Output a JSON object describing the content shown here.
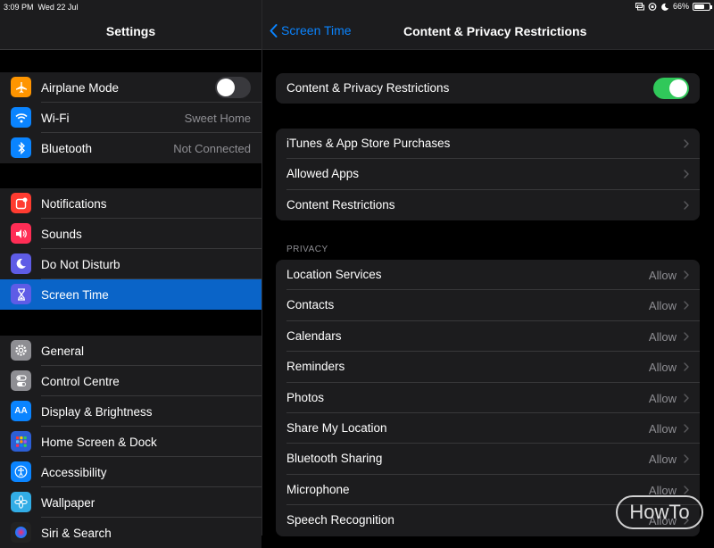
{
  "status_bar": {
    "time": "3:09 PM",
    "date": "Wed 22 Jul",
    "battery_percent": "66%",
    "battery_level": 0.66,
    "icons": [
      "screen-mirroring-icon",
      "orientation-lock-icon",
      "do-not-disturb-moon-icon"
    ]
  },
  "sidebar": {
    "title": "Settings",
    "groups": [
      {
        "items": [
          {
            "label": "Airplane Mode",
            "icon": "airplane-icon",
            "color": "#ff9500",
            "toggle": false
          },
          {
            "label": "Wi-Fi",
            "icon": "wifi-icon",
            "color": "#0a84ff",
            "value": "Sweet Home"
          },
          {
            "label": "Bluetooth",
            "icon": "bluetooth-icon",
            "color": "#0a84ff",
            "value": "Not Connected"
          }
        ]
      },
      {
        "items": [
          {
            "label": "Notifications",
            "icon": "notifications-icon",
            "color": "#ff3b30"
          },
          {
            "label": "Sounds",
            "icon": "speaker-icon",
            "color": "#ff2d55"
          },
          {
            "label": "Do Not Disturb",
            "icon": "moon-icon",
            "color": "#5e5ce6"
          },
          {
            "label": "Screen Time",
            "icon": "hourglass-icon",
            "color": "#5e5ce6",
            "selected": true
          }
        ]
      },
      {
        "items": [
          {
            "label": "General",
            "icon": "gear-icon",
            "color": "#8e8e93"
          },
          {
            "label": "Control Centre",
            "icon": "toggles-icon",
            "color": "#8e8e93"
          },
          {
            "label": "Display & Brightness",
            "icon": "text-size-icon",
            "color": "#0a84ff"
          },
          {
            "label": "Home Screen & Dock",
            "icon": "app-grid-icon",
            "color": "#2c5fd6"
          },
          {
            "label": "Accessibility",
            "icon": "accessibility-icon",
            "color": "#0a84ff"
          },
          {
            "label": "Wallpaper",
            "icon": "flower-icon",
            "color": "#32ade6"
          },
          {
            "label": "Siri & Search",
            "icon": "siri-icon",
            "color": "#222"
          }
        ]
      }
    ],
    "icon_glyphs": {
      "text-size-icon": "AA"
    }
  },
  "main": {
    "back_label": "Screen Time",
    "title": "Content & Privacy Restrictions",
    "toggle_row": {
      "label": "Content & Privacy Restrictions",
      "on": true
    },
    "store_rows": [
      {
        "label": "iTunes & App Store Purchases"
      },
      {
        "label": "Allowed Apps"
      },
      {
        "label": "Content Restrictions"
      }
    ],
    "privacy_header": "PRIVACY",
    "privacy_rows": [
      {
        "label": "Location Services",
        "value": "Allow"
      },
      {
        "label": "Contacts",
        "value": "Allow"
      },
      {
        "label": "Calendars",
        "value": "Allow"
      },
      {
        "label": "Reminders",
        "value": "Allow"
      },
      {
        "label": "Photos",
        "value": "Allow"
      },
      {
        "label": "Share My Location",
        "value": "Allow"
      },
      {
        "label": "Bluetooth Sharing",
        "value": "Allow"
      },
      {
        "label": "Microphone",
        "value": "Allow"
      },
      {
        "label": "Speech Recognition",
        "value": "Allow"
      }
    ]
  },
  "watermark": {
    "text": "HowTo"
  },
  "colors": {
    "accent": "#0a84ff",
    "selected_row": "#0a64c8",
    "toggle_on": "#30c85a",
    "row_bg": "#1c1c1e",
    "secondary_text": "#8e8e93"
  }
}
